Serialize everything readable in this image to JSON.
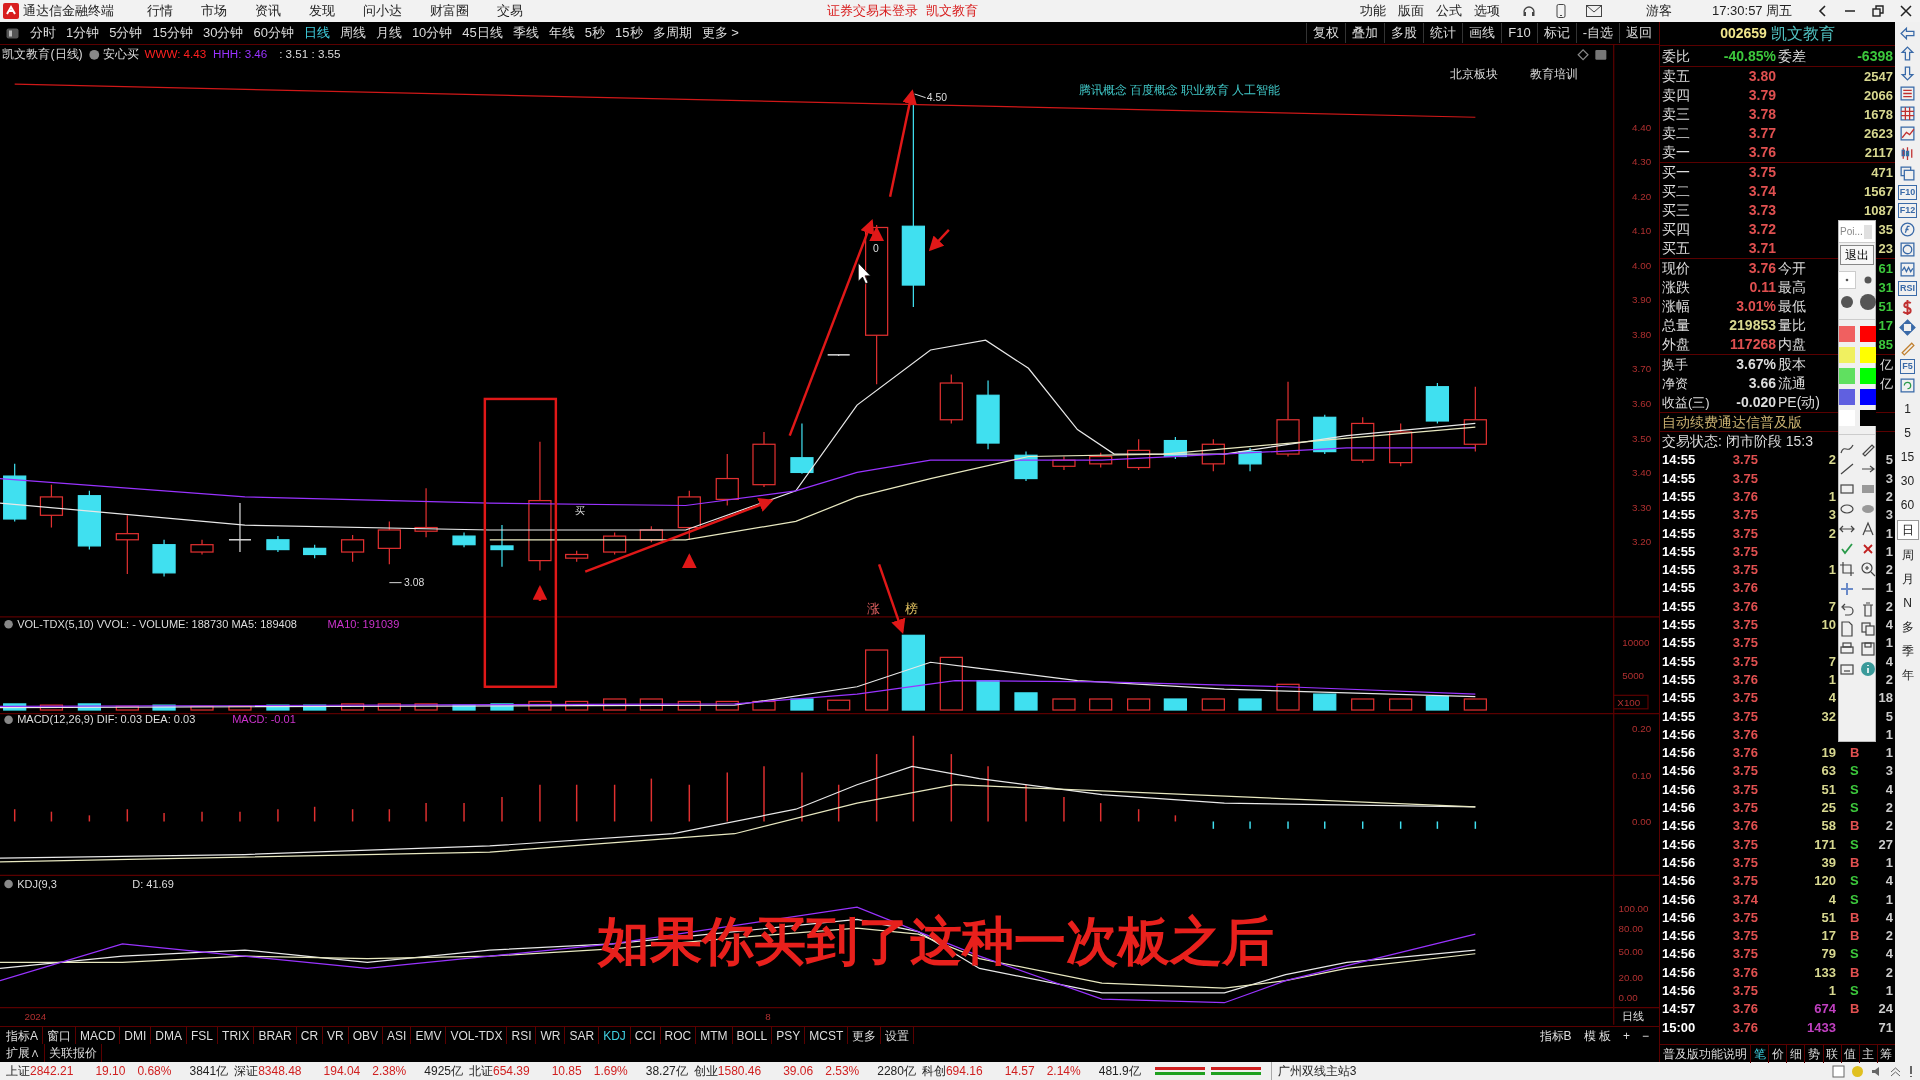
{
  "title_bar": {
    "app_name": "通达信金融终端",
    "menus": [
      "行情",
      "市场",
      "资讯",
      "发现",
      "问小达",
      "财富圈",
      "交易"
    ],
    "notice": "证券交易未登录",
    "account": "凯文教育",
    "right_menus": [
      "功能",
      "版面",
      "公式",
      "选项"
    ],
    "user": "游客",
    "clock": "17:30:57 周五"
  },
  "toolbar": {
    "periods": [
      {
        "label": "分时",
        "selected": false
      },
      {
        "label": "1分钟",
        "selected": false
      },
      {
        "label": "5分钟",
        "selected": false
      },
      {
        "label": "15分钟",
        "selected": false
      },
      {
        "label": "30分钟",
        "selected": false
      },
      {
        "label": "60分钟",
        "selected": false
      },
      {
        "label": "日线",
        "selected": true
      },
      {
        "label": "周线",
        "selected": false
      },
      {
        "label": "月线",
        "selected": false
      },
      {
        "label": "10分钟",
        "selected": false
      },
      {
        "label": "45日线",
        "selected": false
      },
      {
        "label": "季线",
        "selected": false
      },
      {
        "label": "年线",
        "selected": false
      },
      {
        "label": "5秒",
        "selected": false
      },
      {
        "label": "15秒",
        "selected": false
      },
      {
        "label": "多周期",
        "selected": false
      },
      {
        "label": "更多 >",
        "selected": false
      }
    ],
    "actions": [
      "复权",
      "叠加",
      "多股",
      "统计",
      "画线",
      "F10",
      "标记",
      "-自选",
      "返回"
    ]
  },
  "chart": {
    "header": {
      "title": "凯文教育(日线)",
      "badge": "安心买",
      "values": [
        {
          "text": "WWW: 4.43",
          "color": "#ff2020"
        },
        {
          "text": "HHH: 3.46",
          "color": "#9933ff"
        },
        {
          "text": ": 3.51 : 3.55",
          "color": "#dddddd"
        }
      ]
    },
    "concepts": "腾讯概念 百度概念 职业教育 人工智能",
    "sector_tags": [
      "北京板块",
      "教育培训"
    ],
    "marks": {
      "high": "4.50",
      "low": "3.08",
      "zero": "0",
      "buy": "买",
      "limit_up": "涨",
      "ranking": "榜"
    },
    "price_axis": [
      "4.40",
      "4.30",
      "4.20",
      "4.10",
      "4.00",
      "3.90",
      "3.80",
      "3.70",
      "3.60",
      "3.50",
      "3.40",
      "3.30",
      "3.20"
    ],
    "volume": {
      "header": [
        {
          "text": "VOL-TDX(5,10) VVOL: - VOLUME: 188730 MA5: 189408",
          "color": "#dddddd"
        },
        {
          "text": "MA10: 191039",
          "color": "#cc33cc"
        }
      ],
      "axis": [
        "10000",
        "5000"
      ],
      "unit": "X100"
    },
    "macd": {
      "header": [
        {
          "text": "MACD(12,26,9) DIF: 0.03 DEA: 0.03",
          "color": "#dddddd"
        },
        {
          "text": "MACD: -0.01",
          "color": "#cc33cc"
        }
      ],
      "axis": [
        "0.20",
        "0.10",
        "0.00"
      ]
    },
    "kdj": {
      "header": [
        {
          "text": "KDJ(9,3",
          "color": "#dddddd"
        },
        {
          "text": "D: 41.69",
          "color": "#dddddd"
        }
      ],
      "axis": [
        "100.00",
        "80.00",
        "50.00",
        "20.00",
        "0.00"
      ]
    },
    "date_axis": [
      "2024",
      "8"
    ],
    "period_label": "日线"
  },
  "video_caption": "如果你买到了这种一次板之后",
  "indicator_tabs": [
    {
      "label": "指标A",
      "selected": false
    },
    {
      "label": "窗口",
      "selected": false
    },
    {
      "label": "MACD",
      "selected": false
    },
    {
      "label": "DMI",
      "selected": false
    },
    {
      "label": "DMA",
      "selected": false
    },
    {
      "label": "FSL",
      "selected": false
    },
    {
      "label": "TRIX",
      "selected": false
    },
    {
      "label": "BRAR",
      "selected": false
    },
    {
      "label": "CR",
      "selected": false
    },
    {
      "label": "VR",
      "selected": false
    },
    {
      "label": "OBV",
      "selected": false
    },
    {
      "label": "ASI",
      "selected": false
    },
    {
      "label": "EMV",
      "selected": false
    },
    {
      "label": "VOL-TDX",
      "selected": false
    },
    {
      "label": "RSI",
      "selected": false
    },
    {
      "label": "WR",
      "selected": false
    },
    {
      "label": "SAR",
      "selected": false
    },
    {
      "label": "KDJ",
      "selected": true
    },
    {
      "label": "CCI",
      "selected": false
    },
    {
      "label": "ROC",
      "selected": false
    },
    {
      "label": "MTM",
      "selected": false
    },
    {
      "label": "BOLL",
      "selected": false
    },
    {
      "label": "PSY",
      "selected": false
    },
    {
      "label": "MCST",
      "selected": false
    },
    {
      "label": "更多",
      "selected": false
    },
    {
      "label": "设置",
      "selected": false
    }
  ],
  "indicator_tabs_right": [
    "指标B",
    "模 板",
    "+",
    "−"
  ],
  "extension_tabs": [
    "扩展∧",
    "关联报价"
  ],
  "quote_panel": {
    "code": "002659",
    "name": "凯文教育",
    "ratio": {
      "label": "委比",
      "value": "-40.85%",
      "diff_label": "委差",
      "diff": "-6398"
    },
    "asks": [
      {
        "label": "卖五",
        "price": "3.80",
        "volume": "2547"
      },
      {
        "label": "卖四",
        "price": "3.79",
        "volume": "2066"
      },
      {
        "label": "卖三",
        "price": "3.78",
        "volume": "1678"
      },
      {
        "label": "卖二",
        "price": "3.77",
        "volume": "2623"
      },
      {
        "label": "卖一",
        "price": "3.76",
        "volume": "2117"
      }
    ],
    "bids": [
      {
        "label": "买一",
        "price": "3.75",
        "volume": "471"
      },
      {
        "label": "买二",
        "price": "3.74",
        "volume": "1567"
      },
      {
        "label": "买三",
        "price": "3.73",
        "volume": "1087"
      },
      {
        "label": "买四",
        "price": "3.72",
        "volume": "35"
      },
      {
        "label": "买五",
        "price": "3.71",
        "volume": "23"
      }
    ],
    "stats": [
      {
        "label": "现价",
        "value": "3.76",
        "kind": "up",
        "label2": "今开",
        "value2": "61"
      },
      {
        "label": "涨跌",
        "value": "0.11",
        "kind": "up",
        "label2": "最高",
        "value2": "31"
      },
      {
        "label": "涨幅",
        "value": "3.01%",
        "kind": "up",
        "label2": "最低",
        "value2": "51"
      },
      {
        "label": "总量",
        "value": "219853",
        "kind": "volume",
        "label2": "量比",
        "value2": "17"
      },
      {
        "label": "外盘",
        "value": "117268",
        "kind": "up",
        "label2": "内盘",
        "value2": "85"
      }
    ],
    "fundamentals": [
      {
        "label": "换手",
        "value": "3.67%",
        "label2": "股本",
        "value2": "亿"
      },
      {
        "label": "净资",
        "value": "3.66",
        "label2": "流通",
        "value2": "亿"
      },
      {
        "label": "收益(三)",
        "value": "-0.020",
        "label2": "PE(动)"
      }
    ],
    "notice": "自动续费通达信普及版",
    "status": "交易状态: 闭市阶段 15:3",
    "ticks": [
      {
        "time": "14:55",
        "price": "3.75",
        "volume": "2",
        "extra": "5"
      },
      {
        "time": "14:55",
        "price": "3.75",
        "extra": "3"
      },
      {
        "time": "14:55",
        "price": "3.76",
        "volume": "1",
        "extra": "2"
      },
      {
        "time": "14:55",
        "price": "3.75",
        "volume": "3",
        "extra": "3"
      },
      {
        "time": "14:55",
        "price": "3.75",
        "volume": "2",
        "extra": "1"
      },
      {
        "time": "14:55",
        "price": "3.75",
        "extra": "1"
      },
      {
        "time": "14:55",
        "price": "3.75",
        "volume": "1",
        "extra": "2"
      },
      {
        "time": "14:55",
        "price": "3.76",
        "extra": "1"
      },
      {
        "time": "14:55",
        "price": "3.76",
        "volume": "7",
        "extra": "2"
      },
      {
        "time": "14:55",
        "price": "3.75",
        "volume": "10",
        "extra": "4"
      },
      {
        "time": "14:55",
        "price": "3.75",
        "extra": "1"
      },
      {
        "time": "14:55",
        "price": "3.75",
        "volume": "7",
        "extra": "4"
      },
      {
        "time": "14:55",
        "price": "3.76",
        "volume": "1",
        "extra": "2"
      },
      {
        "time": "14:55",
        "price": "3.75",
        "volume": "4",
        "extra": "18"
      },
      {
        "time": "14:55",
        "price": "3.75",
        "volume": "32",
        "extra": "5"
      },
      {
        "time": "14:56",
        "price": "3.76",
        "extra": "1"
      },
      {
        "time": "14:56",
        "price": "3.76",
        "volume": "19",
        "side": "B",
        "kind": "buy",
        "extra": "1"
      },
      {
        "time": "14:56",
        "price": "3.75",
        "volume": "63",
        "side": "S",
        "kind": "sell",
        "extra": "3"
      },
      {
        "time": "14:56",
        "price": "3.75",
        "volume": "51",
        "side": "S",
        "kind": "sell",
        "extra": "4"
      },
      {
        "time": "14:56",
        "price": "3.75",
        "volume": "25",
        "side": "S",
        "kind": "sell",
        "extra": "2"
      },
      {
        "time": "14:56",
        "price": "3.76",
        "volume": "58",
        "side": "B",
        "kind": "buy",
        "extra": "2"
      },
      {
        "time": "14:56",
        "price": "3.75",
        "volume": "171",
        "side": "S",
        "kind": "sell",
        "extra": "27"
      },
      {
        "time": "14:56",
        "price": "3.75",
        "volume": "39",
        "side": "B",
        "kind": "buy",
        "extra": "1"
      },
      {
        "time": "14:56",
        "price": "3.75",
        "volume": "120",
        "side": "S",
        "kind": "sell",
        "extra": "4"
      },
      {
        "time": "14:56",
        "price": "3.74",
        "volume": "4",
        "side": "S",
        "kind": "sell",
        "extra": "1"
      },
      {
        "time": "14:56",
        "price": "3.75",
        "volume": "51",
        "side": "B",
        "kind": "buy",
        "extra": "4"
      },
      {
        "time": "14:56",
        "price": "3.75",
        "volume": "17",
        "side": "B",
        "kind": "buy",
        "extra": "2"
      },
      {
        "time": "14:56",
        "price": "3.75",
        "volume": "79",
        "side": "S",
        "kind": "sell",
        "extra": "4"
      },
      {
        "time": "14:56",
        "price": "3.76",
        "volume": "133",
        "side": "B",
        "kind": "buy",
        "extra": "2"
      },
      {
        "time": "14:56",
        "price": "3.75",
        "volume": "1",
        "side": "S",
        "kind": "sell",
        "extra": "1"
      },
      {
        "time": "14:57",
        "price": "3.76",
        "volume": "674",
        "side": "B",
        "kind": "buy",
        "extra": "24",
        "large": true
      },
      {
        "time": "15:00",
        "price": "3.76",
        "volume": "1433",
        "extra": "71",
        "large": true
      }
    ],
    "bottom_tabs": [
      {
        "label": "普及版功能说明",
        "selected": false
      },
      {
        "label": "笔",
        "selected": true
      },
      {
        "label": "价",
        "selected": false
      },
      {
        "label": "细",
        "selected": false
      },
      {
        "label": "势",
        "selected": false
      },
      {
        "label": "联",
        "selected": false
      },
      {
        "label": "值",
        "selected": false
      },
      {
        "label": "主",
        "selected": false
      },
      {
        "label": "筹",
        "selected": false
      }
    ]
  },
  "drawing_palette": {
    "title": "Poi...",
    "exit": "退出",
    "swatches": [
      {
        "color": "#f06060"
      },
      {
        "color": "#ff0000"
      },
      {
        "color": "#f0f060"
      },
      {
        "color": "#ffff00"
      },
      {
        "color": "#60e060"
      },
      {
        "color": "#00ff00"
      },
      {
        "color": "#6060e0"
      },
      {
        "color": "#0000ff"
      },
      {
        "color": "#ffffff"
      },
      {
        "color": "#000000"
      }
    ]
  },
  "side_toolbar": {
    "labels": [
      "F10",
      "F12",
      "RSI",
      "F5"
    ],
    "periods": [
      {
        "label": "1",
        "selected": false
      },
      {
        "label": "5",
        "selected": false
      },
      {
        "label": "15",
        "selected": false
      },
      {
        "label": "30",
        "selected": false
      },
      {
        "label": "60",
        "selected": false
      },
      {
        "label": "日",
        "selected": true
      },
      {
        "label": "周",
        "selected": false
      },
      {
        "label": "月",
        "selected": false
      },
      {
        "label": "N",
        "selected": false
      },
      {
        "label": "多",
        "selected": false
      },
      {
        "label": "季",
        "selected": false
      },
      {
        "label": "年",
        "selected": false
      }
    ]
  },
  "status_bar": {
    "indices": [
      {
        "name": "上证",
        "price": "2842.21",
        "change": "19.10",
        "pct": "0.68%",
        "amount": "3841亿",
        "kind": "up"
      },
      {
        "name": "深证",
        "price": "8348.48",
        "change": "194.04",
        "pct": "2.38%",
        "amount": "4925亿",
        "kind": "up"
      },
      {
        "name": "北证",
        "price": "654.39",
        "change": "10.85",
        "pct": "1.69%",
        "amount": "38.27亿",
        "kind": "up"
      },
      {
        "name": "创业",
        "price": "1580.46",
        "change": "39.06",
        "pct": "2.53%",
        "amount": "2280亿",
        "kind": "up"
      },
      {
        "name": "科创",
        "price": "694.16",
        "change": "14.57",
        "pct": "2.14%",
        "amount": "481.9亿",
        "kind": "up"
      }
    ],
    "server": "广州双线主站3"
  }
}
